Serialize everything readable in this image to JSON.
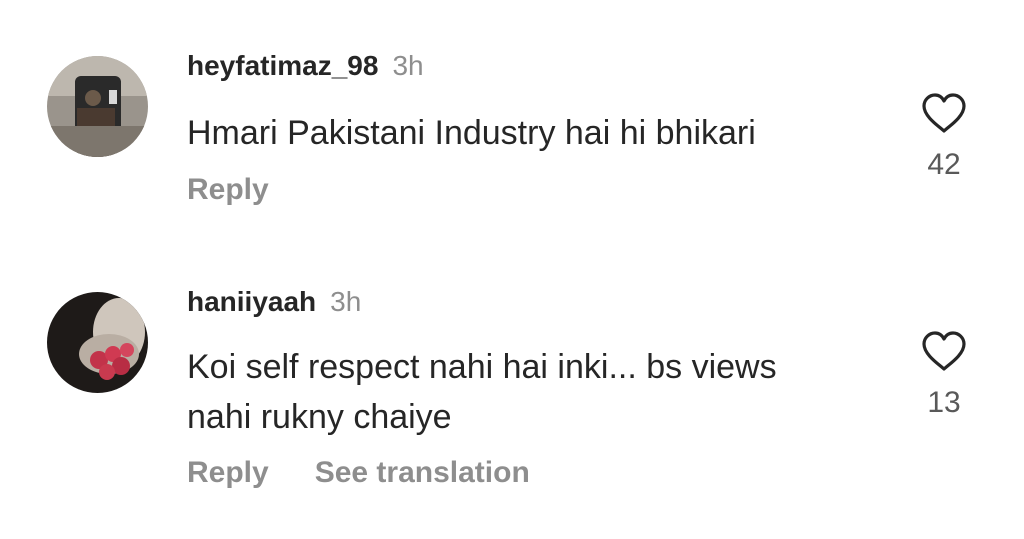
{
  "comments": [
    {
      "username": "heyfatimaz_98",
      "time": "3h",
      "text": "Hmari Pakistani Industry hai hi bhikari",
      "actions": {
        "reply": "Reply"
      },
      "likes": "42",
      "like_icon": "heart-outline-icon"
    },
    {
      "username": "haniiyaah",
      "time": "3h",
      "text": "Koi self respect nahi hai inki... bs views nahi rukny chaiye",
      "actions": {
        "reply": "Reply",
        "translate": "See translation"
      },
      "likes": "13",
      "like_icon": "heart-outline-icon"
    }
  ]
}
